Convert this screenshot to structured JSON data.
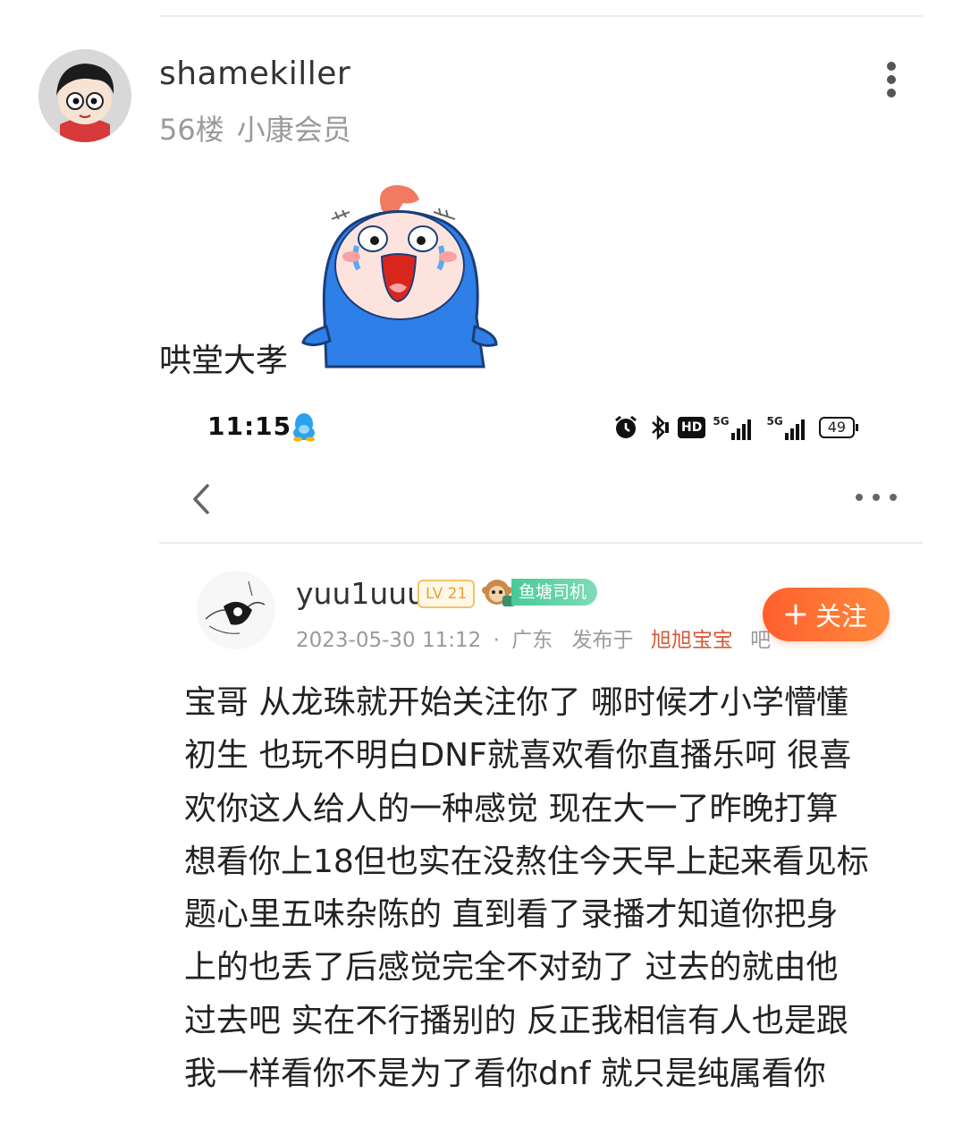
{
  "post": {
    "username": "shamekiller",
    "floor": "56楼",
    "member": "小康会员",
    "text": "哄堂大孝"
  },
  "screenshot": {
    "status_bar": {
      "time": "11:15",
      "hd": "HD",
      "signal1": "5G",
      "signal2": "5G",
      "battery": "49"
    },
    "comment": {
      "username": "yuu1uuu",
      "level": "LV 21",
      "badge": "鱼塘司机",
      "date": "2023-05-30 11:12",
      "separator": "·",
      "location": "广东",
      "posted_in": "发布于",
      "bar_name": "旭旭宝宝",
      "bar_suffix": "吧",
      "follow_label": "关注",
      "body_lines": [
        "宝哥 从龙珠就开始关注你了 哪时候才小学懵懂",
        "初生 也玩不明白DNF就喜欢看你直播乐呵 很喜",
        "欢你这人给人的一种感觉 现在大一了昨晚打算",
        "想看你上18但也实在没熬住今天早上起来看见标",
        "题心里五味杂陈的 直到看了录播才知道你把身",
        "上的也丢了后感觉完全不对劲了 过去的就由他",
        "过去吧 实在不行播别的 反正我相信有人也是跟",
        "我一样看你不是为了看你dnf 就只是纯属看你"
      ]
    }
  },
  "colors": {
    "accent_orange": "#ff6a30",
    "badge_green": "#49c99a",
    "bar_link": "#d25a38",
    "meta_gray": "#9a9a9a"
  },
  "icons": [
    "avatar",
    "more-vertical-icon",
    "sticker-image",
    "qq-penguin-icon",
    "alarm-icon",
    "bluetooth-icon",
    "hd-icon",
    "signal-icon",
    "battery-icon",
    "back-chevron-icon",
    "more-horizontal-icon",
    "plus-icon"
  ]
}
